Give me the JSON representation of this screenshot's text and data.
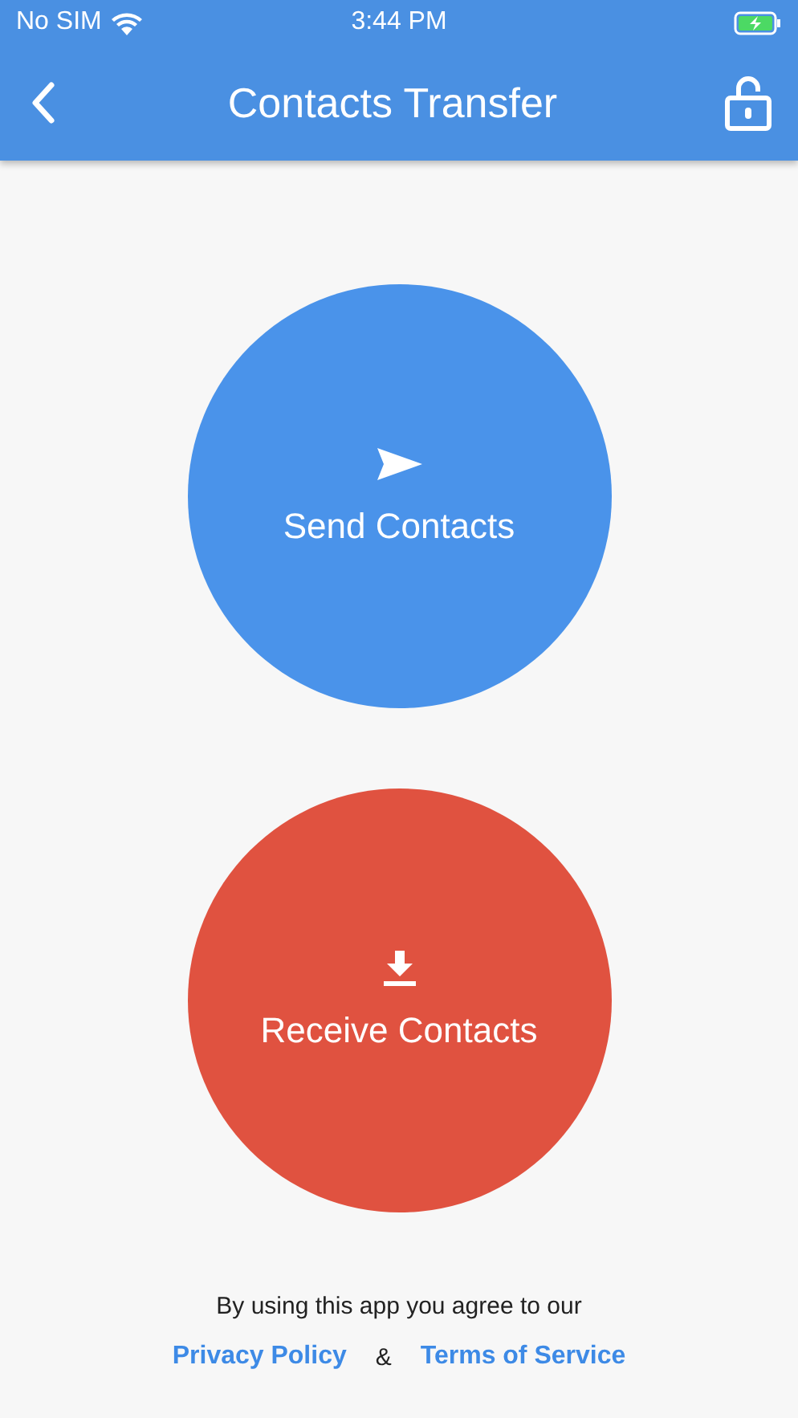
{
  "status_bar": {
    "carrier": "No SIM",
    "time": "3:44 PM"
  },
  "header": {
    "title": "Contacts Transfer"
  },
  "actions": [
    {
      "label": "Send Contacts",
      "kind": "send",
      "color": "#4a93ea"
    },
    {
      "label": "Receive Contacts",
      "kind": "receive",
      "color": "#e05240"
    }
  ],
  "footer": {
    "text": "By using this app you agree to our",
    "links": [
      "Privacy Policy",
      "Terms of Service"
    ],
    "separator": "&"
  }
}
